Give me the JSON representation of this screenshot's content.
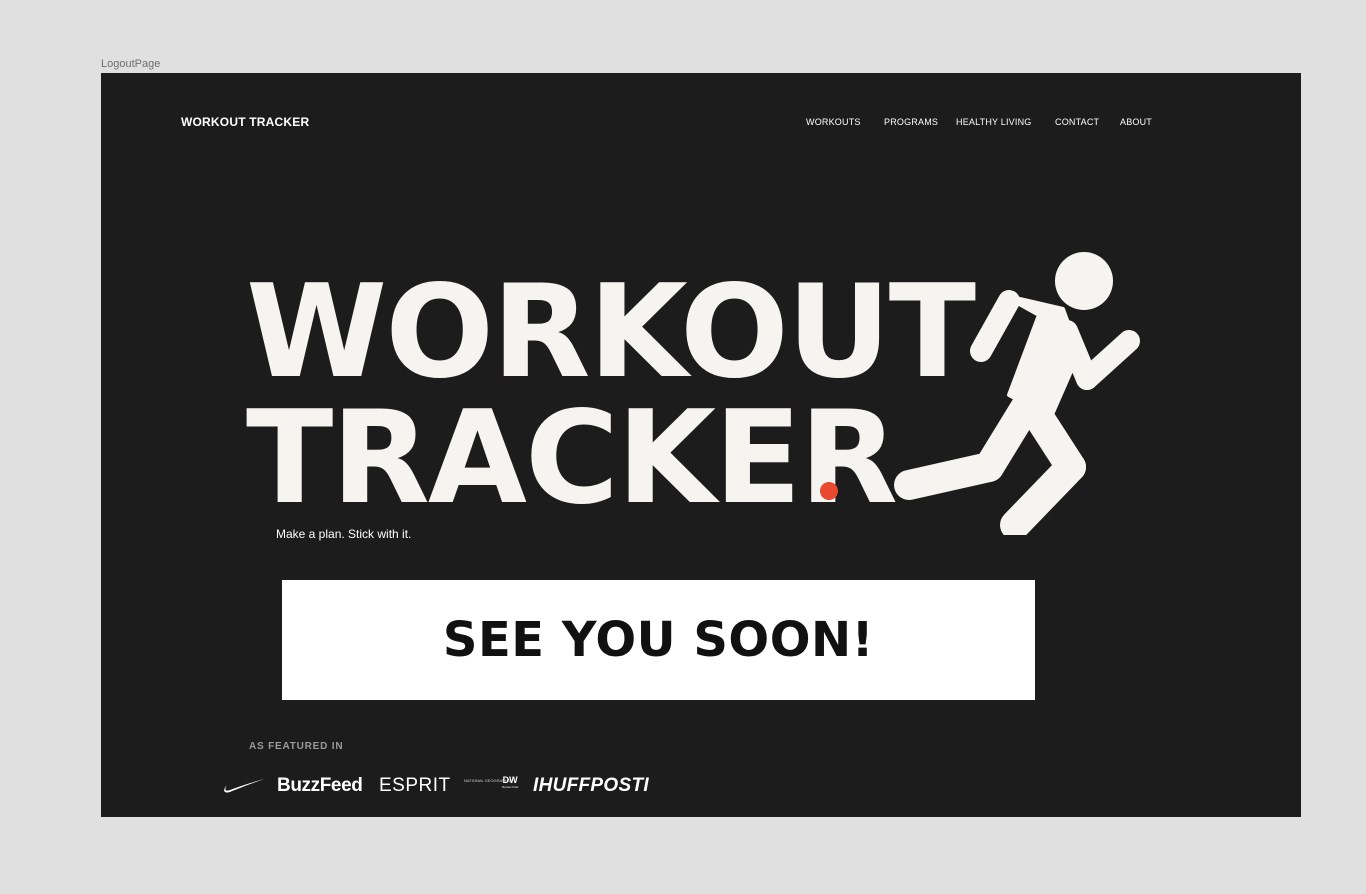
{
  "frame": {
    "label": "LogoutPage"
  },
  "header": {
    "brand": "WORKOUT TRACKER",
    "nav": [
      "WORKOUTS",
      "PROGRAMS",
      "HEALTHY LIVING",
      "CONTACT",
      "ABOUT"
    ]
  },
  "hero": {
    "line1": "WORKOUT",
    "line2": "TRACKER",
    "tagline": "Make a plan. Stick with it.",
    "accent_color": "#e8492f",
    "icon": "running-man-icon"
  },
  "cta": {
    "label": "SEE YOU SOON!"
  },
  "featured": {
    "label": "AS FEATURED IN",
    "logos": {
      "nike": "nike-swoosh-icon",
      "buzzfeed": "BuzzFeed",
      "esprit": "ESPRIT",
      "natgeo": "NATIONAL GEOGRAPHIC",
      "dw": "DW",
      "dw_sub": "Nomex First",
      "huffpost": "IHUFFPOSTI"
    }
  },
  "colors": {
    "canvas": "#e0e0e0",
    "page_bg": "#1c1c1c",
    "text": "#ffffff",
    "hero_text": "#f5f4f0",
    "accent": "#e8492f"
  }
}
